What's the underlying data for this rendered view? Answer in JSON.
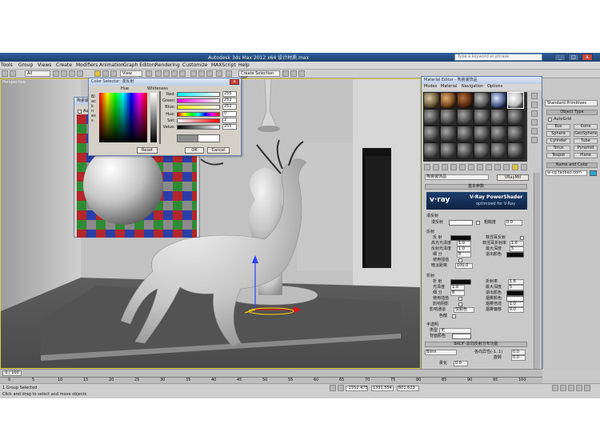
{
  "window": {
    "title": "Autodesk 3ds Max  2012 x64      设计材质.max",
    "search_placeholder": "Type a keyword or phrase",
    "min": "_",
    "max": "□",
    "close": "x"
  },
  "menu": [
    "Tools",
    "Group",
    "Views",
    "Create",
    "Modifiers",
    "Animation",
    "Graph Editors",
    "Rendering",
    "Customize",
    "MAXScript",
    "Help"
  ],
  "toolbar": {
    "selection_filter": "All",
    "ref_coord": "View",
    "named_selection": "Create Selection Set"
  },
  "viewport": {
    "label": "Perspective"
  },
  "preview_window": {
    "title": "陶瓷装饰品",
    "checkbox_label": "Aut"
  },
  "color_selector": {
    "title": "Color Selector: 漫反射",
    "hue_label": "Hue",
    "whiteness_label": "Whiteness",
    "blackness_label": "Blackness",
    "channels": [
      {
        "label": "Red:",
        "value": "255"
      },
      {
        "label": "Green:",
        "value": "252"
      },
      {
        "label": "Blue:",
        "value": "252"
      },
      {
        "label": "Hue:",
        "value": "0"
      },
      {
        "label": "Sat:",
        "value": "2"
      },
      {
        "label": "Value:",
        "value": "255"
      }
    ],
    "reset": "Reset",
    "ok": "OK",
    "cancel": "Cancel"
  },
  "material_editor": {
    "title": "Material Editor - 陶瓷装饰品",
    "menu": [
      "Modes",
      "Material",
      "Navigation",
      "Options"
    ],
    "material_name": "陶瓷装饰品",
    "material_type": "VRayMtl",
    "basic_params": "基本参数",
    "vray_banner_title": "V-Ray PowerShader",
    "vray_banner_sub": "optimized for V-Ray",
    "vray_logo": "v·ray",
    "diffuse_group": "漫反射",
    "diffuse": "漫反射",
    "roughness_label": "粗糙度",
    "roughness": "0.0",
    "reflection_group": "反射",
    "reflect": "反 射",
    "hilight_gloss": "高光光泽度",
    "hilight_value": "1.0",
    "refl_gloss": "反射光泽度",
    "refl_gloss_value": "1.0",
    "subdivs": "细 分",
    "subdivs_value": "8",
    "use_interp": "使用插值",
    "dim_dist": "暗淡距离",
    "dim_value": "100.0",
    "fresnel": "菲涅耳反射",
    "fresnel_ior": "菲涅耳折射率",
    "fresnel_ior_value": "1.6",
    "max_depth": "最大深度",
    "max_depth_value": "5",
    "exit_color": "退出颜色",
    "refraction_group": "折射",
    "refract": "折 射",
    "refract_ior": "折射率",
    "refract_ior_value": "1.6",
    "gloss": "光泽度",
    "gloss_value": "1.0",
    "refract_max_depth": "最大深度",
    "refract_max_depth_value": "5",
    "refract_subdivs": "细 分",
    "refract_subdivs_value": "8",
    "refract_exit": "退出颜色",
    "fog_color": "烟雾颜色",
    "fog_mult": "烟雾倍增",
    "fog_mult_value": "1.0",
    "fog_bias": "烟雾偏移",
    "fog_bias_value": "0.0",
    "affect_shadows": "影响阴影",
    "affect_channels": "影响通道",
    "affect_channels_value": "仅颜色",
    "dispersion": "色散",
    "translucency_group": "半透明",
    "translucency_type": "类型",
    "translucency_value": "无",
    "back_color": "背面颜色",
    "brdf_head": "BRDF-双向反射分布功能",
    "brdf_type": "Blinn",
    "anisotropy": "各向异性(-1..1)",
    "anisotropy_value": "0.0",
    "rotation": "旋转",
    "rotation_value": "0.0",
    "soften": "柔化",
    "soften_value": "0.0"
  },
  "command_panel": {
    "category": "Standard Primitives",
    "object_type": "Object Type",
    "autogrid": "AutoGrid",
    "buttons": [
      "Box",
      "Cone",
      "Sphere",
      "GeoSphere",
      "Cylinder",
      "Tube",
      "Torus",
      "Pyramid",
      "Teapot",
      "Plane"
    ],
    "name_and_color": "Name and Color",
    "name_value": "w-cg.taobao.com"
  },
  "timeline": {
    "ticks": [
      "0",
      "5",
      "10",
      "15",
      "20",
      "25",
      "30",
      "35",
      "40",
      "45",
      "50",
      "55",
      "60",
      "65",
      "70",
      "75",
      "80",
      "85",
      "90",
      "95",
      "100"
    ],
    "frame_counter": "0 / 100"
  },
  "status": {
    "selected": "1 Group Selected",
    "prompt": "Click and drag to select and move objects",
    "x": "-1552.475",
    "y": "1331.554",
    "z": "601.623"
  }
}
